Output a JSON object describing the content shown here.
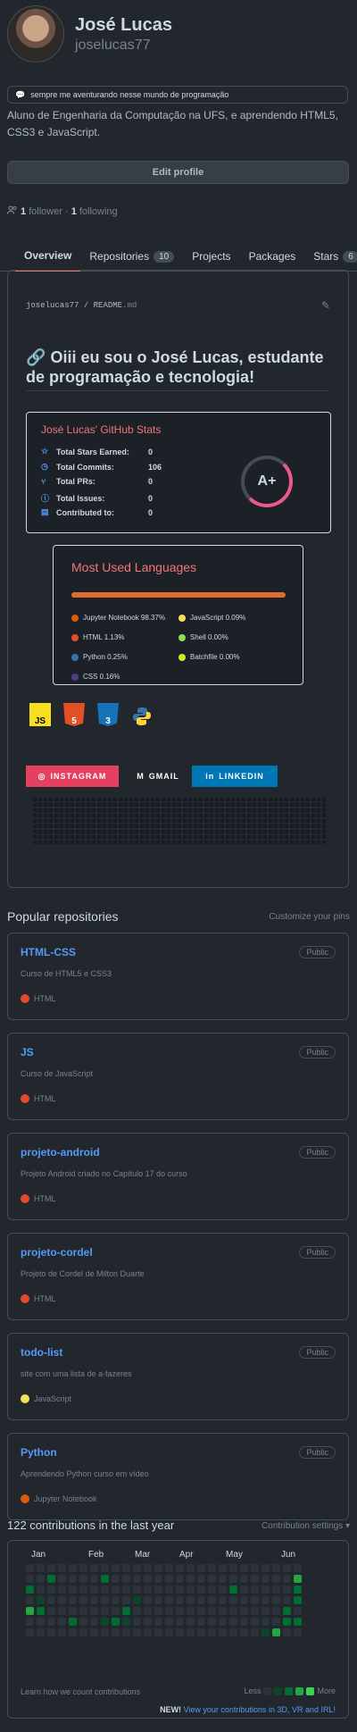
{
  "profile": {
    "full_name": "José Lucas",
    "login": "joselucas77",
    "status": "sempre me aventurando nesse mundo de programação",
    "bio": "Aluno de Engenharia da Computação na UFS, e aprendendo HTML5, CSS3 e JavaScript.",
    "edit_label": "Edit profile",
    "followers": "1",
    "followers_label": "follower",
    "following": "1",
    "following_label": "following"
  },
  "tabs": [
    {
      "label": "Overview",
      "count": ""
    },
    {
      "label": "Repositories",
      "count": "10"
    },
    {
      "label": "Projects",
      "count": ""
    },
    {
      "label": "Packages",
      "count": ""
    },
    {
      "label": "Stars",
      "count": "6"
    }
  ],
  "readme": {
    "path_user": "joselucas77",
    "path_sep": "/",
    "path_file": "README",
    "path_ext": ".md",
    "heading": "Oiii eu sou o José Lucas, estudante de programação e tecnologia!",
    "stats": {
      "title": "José Lucas' GitHub Stats",
      "rows": [
        {
          "label": "Total Stars Earned:",
          "value": "0"
        },
        {
          "label": "Total Commits:",
          "value": "106"
        },
        {
          "label": "Total PRs:",
          "value": "0"
        },
        {
          "label": "Total Issues:",
          "value": "0"
        },
        {
          "label": "Contributed to:",
          "value": "0"
        }
      ],
      "grade": "A+"
    },
    "languages": {
      "title": "Most Used Languages",
      "items": [
        {
          "label": "Jupyter Notebook 98.37%",
          "color": "#DA5B0B"
        },
        {
          "label": "JavaScript 0.09%",
          "color": "#f1e05a"
        },
        {
          "label": "HTML 1.13%",
          "color": "#e34c26"
        },
        {
          "label": "Shell 0.00%",
          "color": "#89e051"
        },
        {
          "label": "Python 0.25%",
          "color": "#3572A5"
        },
        {
          "label": "Batchfile 0.00%",
          "color": "#C1F12E"
        },
        {
          "label": "CSS 0.16%",
          "color": "#563d7c"
        }
      ]
    },
    "tech_icons": [
      "JS",
      "5",
      "3",
      "python-icon"
    ],
    "social": [
      {
        "label": "INSTAGRAM",
        "color": "#E4405F"
      },
      {
        "label": "GMAIL",
        "color": "#22272e"
      },
      {
        "label": "LINKEDIN",
        "color": "#0077B5"
      }
    ]
  },
  "popular": {
    "title": "Popular repositories",
    "customize": "Customize your pins",
    "repos": [
      {
        "name": "HTML-CSS",
        "visibility": "Public",
        "desc": "Curso de HTML5 e CSS3",
        "lang": "HTML",
        "color": "#e34c26"
      },
      {
        "name": "JS",
        "visibility": "Public",
        "desc": "Curso de JavaScript",
        "lang": "HTML",
        "color": "#e34c26"
      },
      {
        "name": "projeto-android",
        "visibility": "Public",
        "desc": "Projeto Android criado no Capítulo 17 do curso",
        "lang": "HTML",
        "color": "#e34c26"
      },
      {
        "name": "projeto-cordel",
        "visibility": "Public",
        "desc": "Projeto de Cordel de Milton Duarte",
        "lang": "HTML",
        "color": "#e34c26"
      },
      {
        "name": "todo-list",
        "visibility": "Public",
        "desc": "site com uma lista de a-fazeres",
        "lang": "JavaScript",
        "color": "#f1e05a"
      },
      {
        "name": "Python",
        "visibility": "Public",
        "desc": "Aprendendo Python curso em vídeo",
        "lang": "Jupyter Notebook",
        "color": "#DA5B0B"
      }
    ]
  },
  "contrib": {
    "title": "122 contributions in the last year",
    "settings": "Contribution settings ▾",
    "months": [
      "Jan",
      "Feb",
      "Mar",
      "Apr",
      "May",
      "Jun"
    ],
    "learn": "Learn how we count contributions",
    "less": "Less",
    "more": "More",
    "new_badge": "NEW!",
    "new_link": "View your contributions in 3D, VR and IRL!",
    "colors": [
      "#2d333b",
      "#0e4429",
      "#006d32",
      "#26a641",
      "#39d353"
    ]
  }
}
